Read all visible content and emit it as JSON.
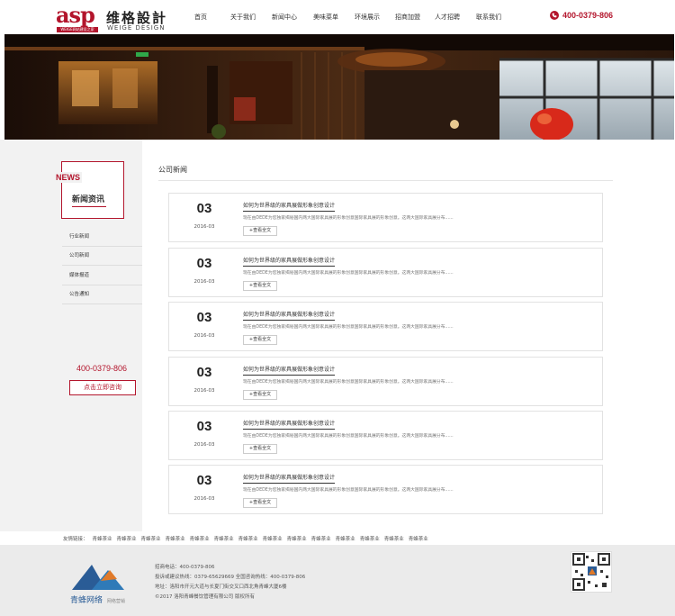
{
  "header": {
    "logo_main": "asp",
    "logo_tag": "WEIGE网站建设之家",
    "logo_cn": "维格設計",
    "logo_en": "WEIGE DESIGN",
    "phone": "400-0379-806"
  },
  "nav": [
    "首页",
    "关于我们",
    "新闻中心",
    "美味菜单",
    "环境展示",
    "招商加盟",
    "人才招聘",
    "联系我们"
  ],
  "sidebar": {
    "news_en": "NEWS",
    "news_cn": "新闻资讯",
    "items": [
      "行业新闻",
      "公司新闻",
      "媒体报道",
      "公告通知"
    ],
    "phone": "400-0379-806",
    "consult_label": "点击立即咨询"
  },
  "main": {
    "section_title": "公司新闻",
    "articles": [
      {
        "day": "03",
        "date": "2016-03",
        "title": "如何为世界级的家具展做形象创意设计",
        "desc": "现在由DEDE为您独家揭秘国内两大国际家具展的形象创意国际家具展的形象创意。这两大国际家具展分布......",
        "more": "+查看全文"
      },
      {
        "day": "03",
        "date": "2016-03",
        "title": "如何为世界级的家具展做形象创意设计",
        "desc": "现在由DEDE为您独家揭秘国内两大国际家具展的形象创意国际家具展的形象创意。这两大国际家具展分布......",
        "more": "+查看全文"
      },
      {
        "day": "03",
        "date": "2016-03",
        "title": "如何为世界级的家具展做形象创意设计",
        "desc": "现在由DEDE为您独家揭秘国内两大国际家具展的形象创意国际家具展的形象创意。这两大国际家具展分布......",
        "more": "+查看全文"
      },
      {
        "day": "03",
        "date": "2016-03",
        "title": "如何为世界级的家具展做形象创意设计",
        "desc": "现在由DEDE为您独家揭秘国内两大国际家具展的形象创意国际家具展的形象创意。这两大国际家具展分布......",
        "more": "+查看全文"
      },
      {
        "day": "03",
        "date": "2016-03",
        "title": "如何为世界级的家具展做形象创意设计",
        "desc": "现在由DEDE为您独家揭秘国内两大国际家具展的形象创意国际家具展的形象创意。这两大国际家具展分布......",
        "more": "+查看全文"
      },
      {
        "day": "03",
        "date": "2016-03",
        "title": "如何为世界级的家具展做形象创意设计",
        "desc": "现在由DEDE为您独家揭秘国内两大国际家具展的形象创意国际家具展的形象创意。这两大国际家具展分布......",
        "more": "+查看全文"
      }
    ]
  },
  "links": {
    "label": "友情链接：",
    "items": [
      "青蜂茶业",
      "青蜂茶业",
      "青蜂茶业",
      "青蜂茶业",
      "青蜂茶业",
      "青蜂茶业",
      "青蜂茶业",
      "青蜂茶业",
      "青蜂茶业",
      "青蜂茶业",
      "青蜂茶业",
      "青蜂茶业",
      "青蜂茶业",
      "青蜂茶业"
    ]
  },
  "footer": {
    "brand": "青蜂网络",
    "brand_sub": "网络营销",
    "lines": [
      "招商电话：400-0379-806",
      "投诉或建议热线：0379-65629669  全国咨询热线：400-0379-806",
      "地址：洛阳市开元大道与长夏门街交叉口西北角青峰大厦6楼",
      "©2017  洛阳青峰餐饮管理有限公司 版权所有"
    ]
  },
  "colors": {
    "accent": "#b3152c",
    "side_bg": "#f2f2f2",
    "footer_bg": "#ebebeb"
  }
}
